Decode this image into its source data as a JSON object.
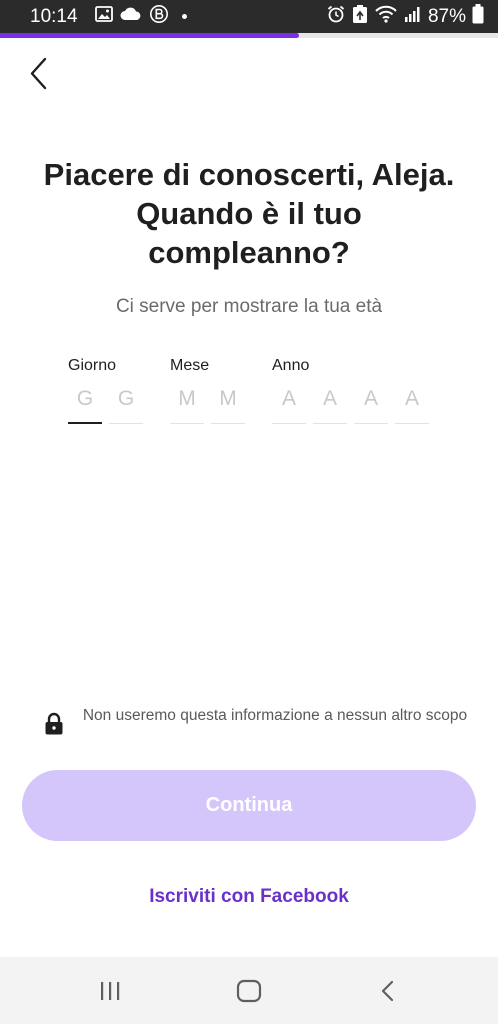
{
  "status_bar": {
    "time": "10:14",
    "battery": "87%",
    "icons": [
      "image-icon",
      "cloud-icon",
      "b-badge-icon",
      "dot-icon",
      "alarm-icon",
      "recycle-icon",
      "wifi-icon",
      "signal-icon",
      "battery-icon"
    ]
  },
  "progress": {
    "value": 0.6,
    "color": "#7a2ee6"
  },
  "header": {
    "back_icon": "chevron-left-icon"
  },
  "title": "Piacere di conoscerti, Aleja. Quando è il tuo compleanno?",
  "subtitle": "Ci serve per mostrare la tua età",
  "date_fields": {
    "day": {
      "label": "Giorno",
      "placeholders": [
        "G",
        "G"
      ]
    },
    "month": {
      "label": "Mese",
      "placeholders": [
        "M",
        "M"
      ]
    },
    "year": {
      "label": "Anno",
      "placeholders": [
        "A",
        "A",
        "A",
        "A"
      ]
    }
  },
  "privacy": {
    "icon": "lock-icon",
    "text": "Non useremo questa informazione a nessun altro scopo"
  },
  "continue_button": {
    "label": "Continua",
    "color": "#d4c6fb"
  },
  "facebook_link": {
    "label": "Iscriviti con Facebook",
    "color": "#6a31c9"
  },
  "nav_bar": {
    "icons": [
      "recent-apps-icon",
      "home-icon",
      "back-icon"
    ]
  }
}
